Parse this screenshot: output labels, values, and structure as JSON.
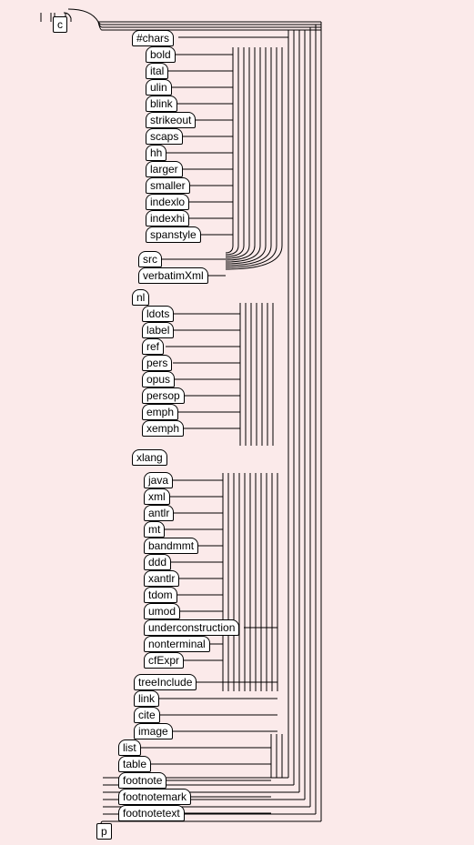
{
  "root_label": "c",
  "p_label": "p",
  "chars_label": "#chars",
  "chars_children": [
    "bold",
    "ital",
    "ulin",
    "blink",
    "strikeout",
    "scaps",
    "hh",
    "larger",
    "smaller",
    "indexlo",
    "indexhi",
    "spanstyle"
  ],
  "post_chars": [
    "src",
    "verbatimXml"
  ],
  "nl_label": "nl",
  "nl_children": [
    "ldots",
    "label",
    "ref",
    "pers",
    "opus",
    "persop",
    "emph",
    "xemph"
  ],
  "xlang_label": "xlang",
  "xlang_children": [
    "java",
    "xml",
    "antlr",
    "mt",
    "bandmmt",
    "ddd",
    "xantlr",
    "tdom",
    "umod",
    "underconstruction",
    "nonterminal",
    "cfExpr"
  ],
  "post_xlang": [
    "treeInclude",
    "link",
    "cite",
    "image"
  ],
  "list_group": [
    "list",
    "table",
    "footnote",
    "footnotemark",
    "footnotetext"
  ]
}
